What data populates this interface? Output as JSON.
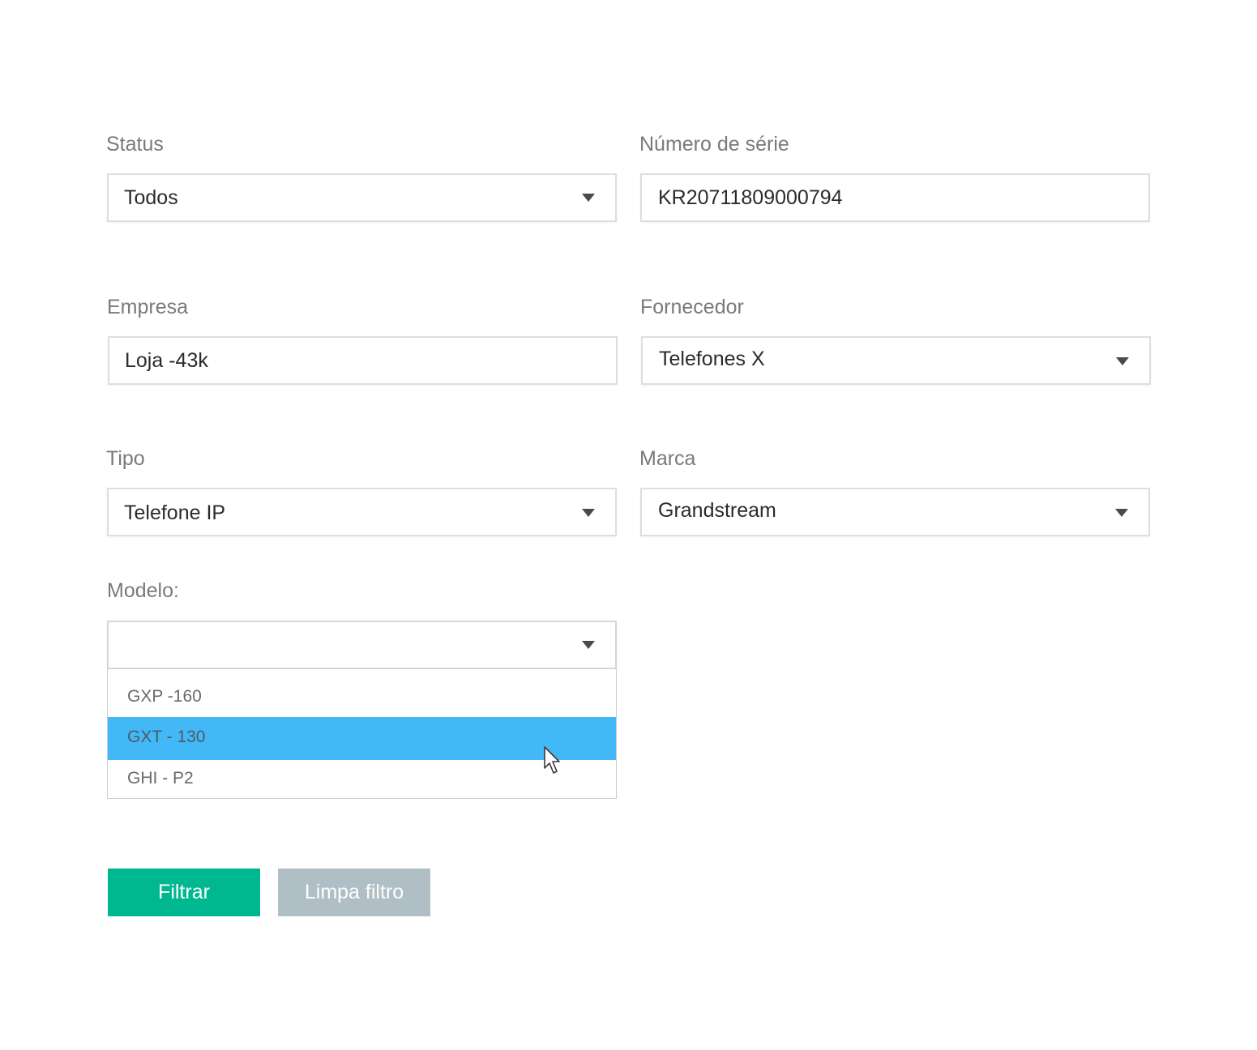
{
  "filters": {
    "status": {
      "label": "Status",
      "value": "Todos"
    },
    "numero_serie": {
      "label": "Número de série",
      "value": "KR20711809000794"
    },
    "empresa": {
      "label": "Empresa",
      "value": "Loja -43k"
    },
    "fornecedor": {
      "label": "Fornecedor",
      "value": "Telefones X"
    },
    "tipo": {
      "label": "Tipo",
      "value": "Telefone IP"
    },
    "marca": {
      "label": "Marca",
      "value": "Grandstream"
    },
    "modelo": {
      "label": "Modelo:",
      "value": "",
      "options": [
        "GXP -160",
        "GXT - 130",
        "GHI - P2"
      ],
      "highlighted_index": 1
    }
  },
  "buttons": {
    "filter_label": "Filtrar",
    "clear_label": "Limpa filtro"
  },
  "colors": {
    "primary_button": "#00b890",
    "secondary_button": "#b0bec5",
    "option_highlight": "#42b8f7",
    "field_border": "#dcdee0"
  },
  "icons": {
    "dropdown": "chevron-down-icon",
    "cursor": "mouse-pointer-icon"
  }
}
